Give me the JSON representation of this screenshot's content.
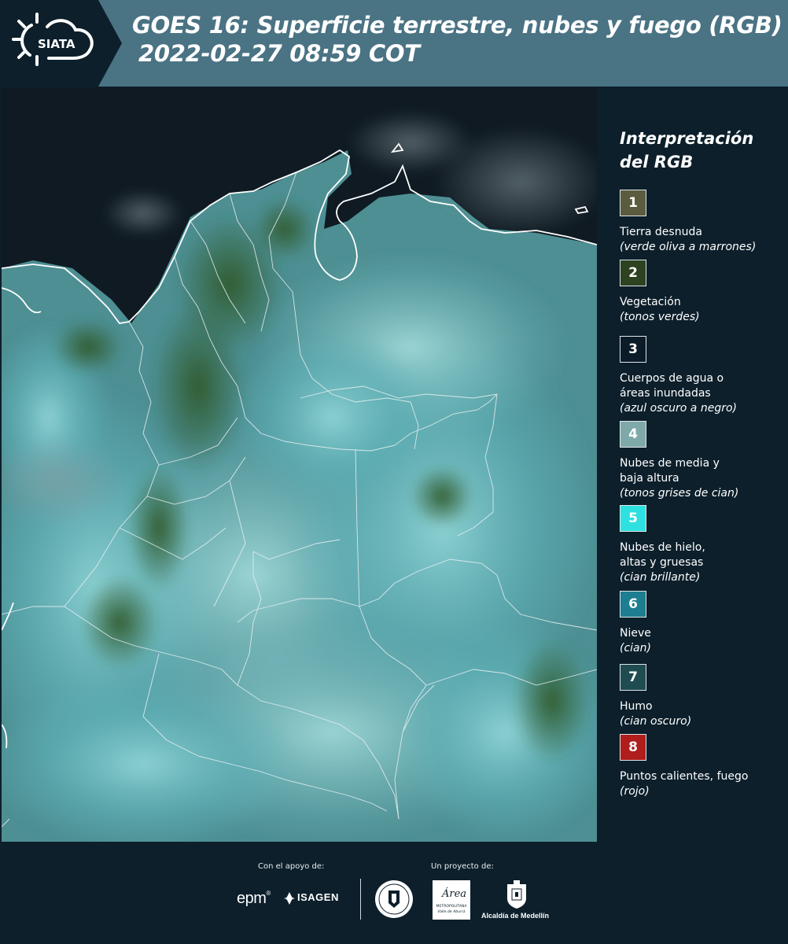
{
  "header": {
    "logo_text": "SIATA",
    "title_line1": "GOES 16: Superficie terrestre, nubes y fuego (RGB)",
    "title_line2": "2022-02-27 08:59 COT"
  },
  "legend": {
    "title_line1": "Interpretación",
    "title_line2": "del RGB",
    "items": [
      {
        "num": "1",
        "color": "#5b5b3e",
        "lines": [
          "Tierra desnuda"
        ],
        "desc": "(verde oliva a marrones)"
      },
      {
        "num": "2",
        "color": "#2c4221",
        "lines": [
          "Vegetación"
        ],
        "desc": "(tonos verdes)"
      },
      {
        "num": "3",
        "color": "#0b1c28",
        "lines": [
          "Cuerpos de agua o",
          "áreas inundadas"
        ],
        "desc": "(azul oscuro a negro)"
      },
      {
        "num": "4",
        "color": "#7fa9a9",
        "lines": [
          "Nubes de media y",
          "baja altura"
        ],
        "desc": "(tonos grises de cian)"
      },
      {
        "num": "5",
        "color": "#2ee0e0",
        "lines": [
          "Nubes de hielo,",
          "altas y gruesas"
        ],
        "desc": "(cian brillante)"
      },
      {
        "num": "6",
        "color": "#1d7d91",
        "lines": [
          "Nieve"
        ],
        "desc": "(cian)"
      },
      {
        "num": "7",
        "color": "#1e4c51",
        "lines": [
          "Humo"
        ],
        "desc": "(cian oscuro)"
      },
      {
        "num": "8",
        "color": "#b01d1d",
        "lines": [
          "Puntos calientes, fuego"
        ],
        "desc": "(rojo)"
      }
    ]
  },
  "footer": {
    "support_caption": "Con el apoyo de:",
    "project_caption": "Un proyecto de:",
    "sponsor_epm": "epm",
    "sponsor_isagen": "ISAGEN",
    "area_metro_main": "Área",
    "area_metro_sub1": "METROPOLITANA",
    "area_metro_sub2": "Valle de Aburrá",
    "alcaldia": "Alcaldía de Medellín"
  }
}
